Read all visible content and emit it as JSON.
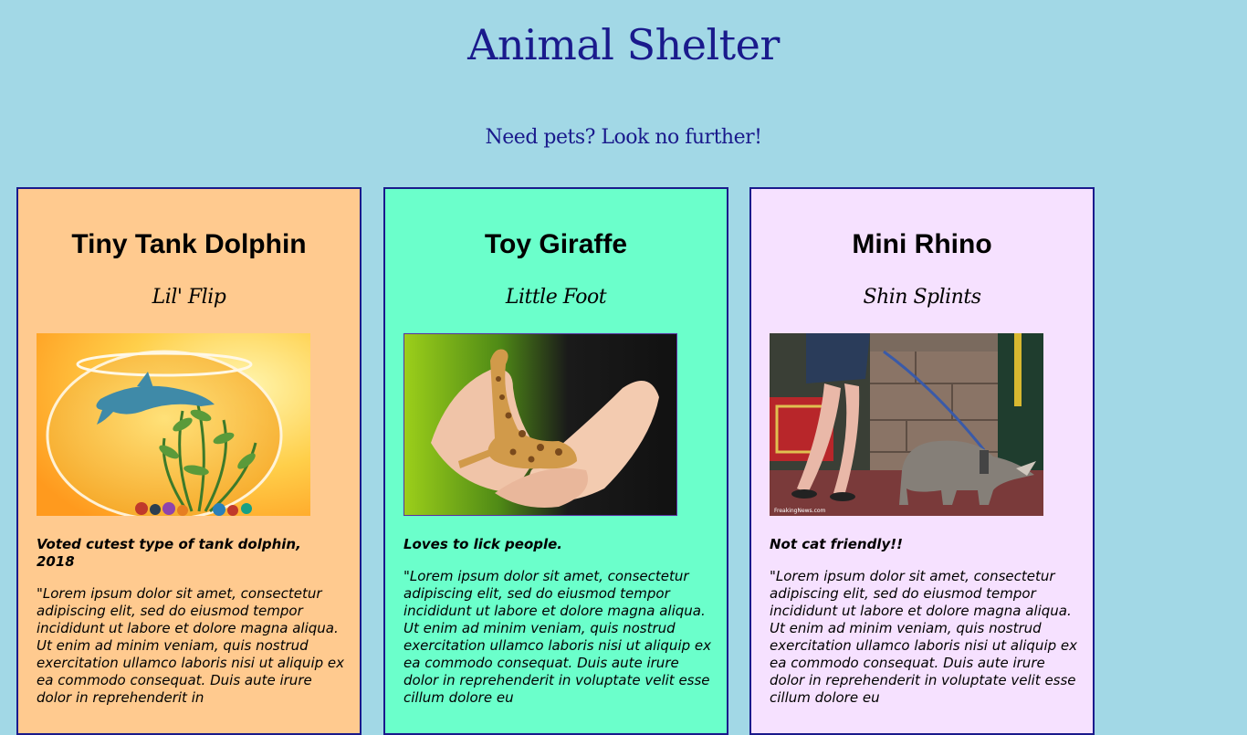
{
  "header": {
    "title": "Animal Shelter",
    "subtitle": "Need pets? Look no further!"
  },
  "pets": [
    {
      "name": "Tiny Tank Dolphin",
      "nickname": "Lil' Flip",
      "tagline": "Voted cutest type of tank dolphin, 2018",
      "description": "\"Lorem ipsum dolor sit amet, consectetur adipiscing elit, sed do eiusmod tempor incididunt ut labore et dolore magna aliqua. Ut enim ad minim veniam, quis nostrud exercitation ullamco laboris nisi ut aliquip ex ea commodo consequat. Duis aute irure dolor in reprehenderit in",
      "background": "#ffca8f"
    },
    {
      "name": "Toy Giraffe",
      "nickname": "Little Foot",
      "tagline": "Loves to lick people.",
      "description": "\"Lorem ipsum dolor sit amet, consectetur adipiscing elit, sed do eiusmod tempor incididunt ut labore et dolore magna aliqua. Ut enim ad minim veniam, quis nostrud exercitation ullamco laboris nisi ut aliquip ex ea commodo consequat. Duis aute irure dolor in reprehenderit in voluptate velit esse cillum dolore eu",
      "background": "#6bffcb"
    },
    {
      "name": "Mini Rhino",
      "nickname": "Shin Splints",
      "tagline": "Not cat friendly!!",
      "description": "\"Lorem ipsum dolor sit amet, consectetur adipiscing elit, sed do eiusmod tempor incididunt ut labore et dolore magna aliqua. Ut enim ad minim veniam, quis nostrud exercitation ullamco laboris nisi ut aliquip ex ea commodo consequat. Duis aute irure dolor in reprehenderit in voluptate velit esse cillum dolore eu",
      "background": "#f6e1ff"
    }
  ],
  "colors": {
    "page_background": "#a2d8e6",
    "heading_color": "#1a1a8c",
    "card_border": "#1a1a8c"
  }
}
